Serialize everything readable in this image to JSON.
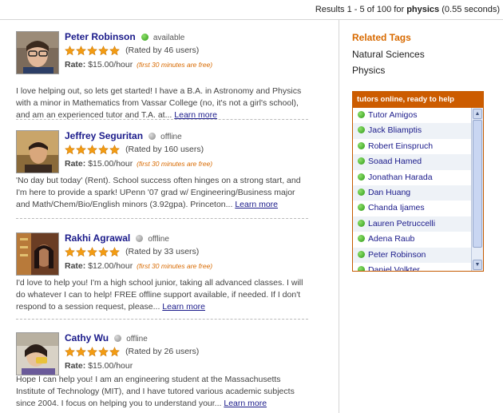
{
  "results": {
    "prefix": "Results 1 - 5 of 100 for",
    "query": "physics",
    "time": "(0.55 seconds)"
  },
  "tutors": [
    {
      "name": "Peter Robinson",
      "status": "available",
      "online": true,
      "rating_stars": 5,
      "rated": "(Rated by 46 users)",
      "rate_label": "Rate:",
      "rate": "$15.00/hour",
      "free": "(first 30 minutes are free)",
      "desc": "I love helping out, so lets get started! I have a B.A. in Astronomy and Physics with a minor in Mathematics from Vassar College (no, it's not a girl's school), and am an experienced tutor and T.A. at...",
      "more": "Learn more"
    },
    {
      "name": "Jeffrey Seguritan",
      "status": "offline",
      "online": false,
      "rating_stars": 5,
      "rated": "(Rated by 160 users)",
      "rate_label": "Rate:",
      "rate": "$15.00/hour",
      "free": "(first 30 minutes are free)",
      "desc": "'No day but today' (Rent). School success often hinges on a strong start, and I'm here to provide a spark! UPenn '07 grad w/ Engineering/Business major and Math/Chem/Bio/English minors (3.92gpa). Princeton...",
      "more": "Learn more"
    },
    {
      "name": "Rakhi Agrawal",
      "status": "offline",
      "online": false,
      "rating_stars": 5,
      "rated": "(Rated by 33 users)",
      "rate_label": "Rate:",
      "rate": "$12.00/hour",
      "free": "(first 30 minutes are free)",
      "desc": "I'd love to help you! I'm a high school junior, taking all advanced classes. I will do whatever I can to help! FREE offline support available, if needed. If I don't respond to a session request, please...",
      "more": "Learn more"
    },
    {
      "name": "Cathy Wu",
      "status": "offline",
      "online": false,
      "rating_stars": 5,
      "rated": "(Rated by 26 users)",
      "rate_label": "Rate:",
      "rate": "$15.00/hour",
      "free": "",
      "desc": "Hope I can help you! I am an engineering student at the Massachusetts Institute of Technology (MIT), and I have tutored various academic subjects since 2004. I focus on helping you to understand your...",
      "more": "Learn more"
    }
  ],
  "related": {
    "title": "Related Tags",
    "tags": [
      "Natural Sciences",
      "Physics"
    ]
  },
  "online_box": {
    "title": "tutors online, ready to help",
    "tutors": [
      "Tutor Amigos",
      "Jack Bliamptis",
      "Robert Einspruch",
      "Soaad Hamed",
      "Jonathan Harada",
      "Dan Huang",
      "Chanda Ijames",
      "Lauren Petruccelli",
      "Adena Raub",
      "Peter Robinson",
      "Daniel Volkter"
    ]
  },
  "colors": {
    "accent": "#cc5c00",
    "link": "#1a1a8a",
    "star": "#f39c12",
    "online": "#2e9a17"
  }
}
